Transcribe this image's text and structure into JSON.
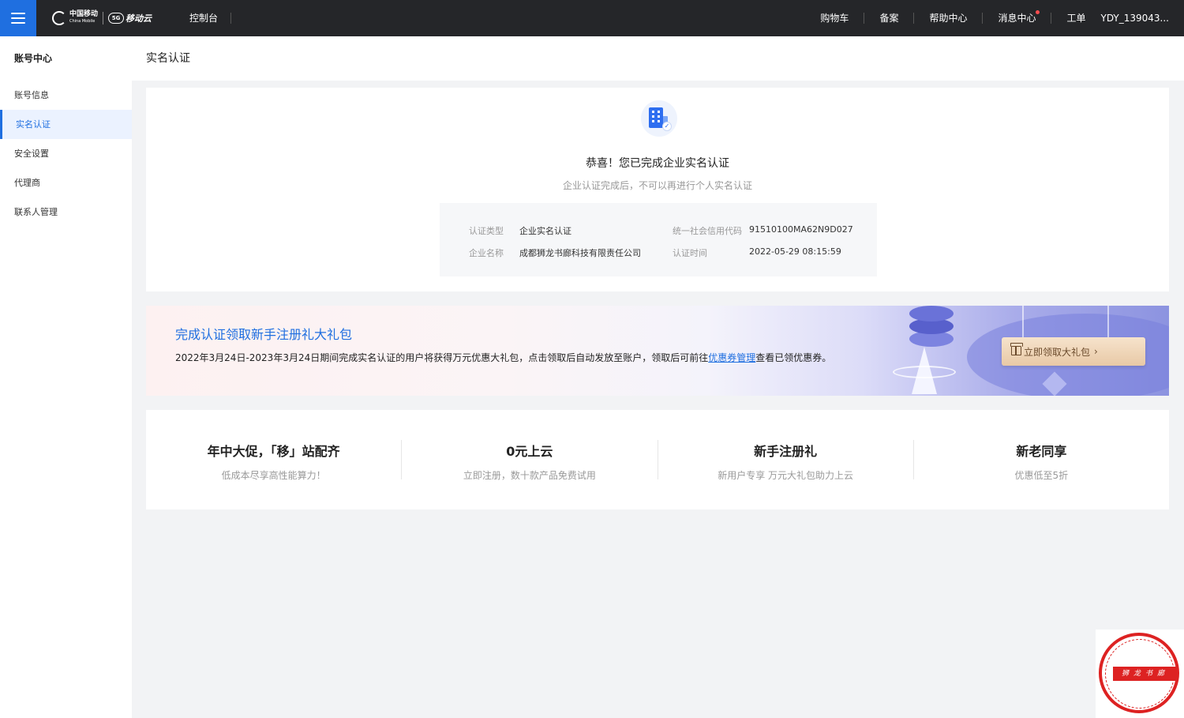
{
  "topbar": {
    "logo_zh": "中国移动",
    "logo_en": "China Mobile",
    "logo_5g": "5G",
    "logo_cloud": "移动云",
    "console": "控制台",
    "links": [
      "购物车",
      "备案",
      "帮助中心",
      "消息中心",
      "工单"
    ],
    "user": "YDY_139043..."
  },
  "sidebar": {
    "title": "账号中心",
    "items": [
      {
        "label": "账号信息"
      },
      {
        "label": "实名认证"
      },
      {
        "label": "安全设置"
      },
      {
        "label": "代理商"
      },
      {
        "label": "联系人管理"
      }
    ],
    "active_index": 1
  },
  "page": {
    "title": "实名认证"
  },
  "verification": {
    "congrats": "恭喜！您已完成企业实名认证",
    "note": "企业认证完成后，不可以再进行个人实名认证",
    "fields": {
      "type_label": "认证类型",
      "type_value": "企业实名认证",
      "code_label": "统一社会信用代码",
      "code_value": "91510100MA62N9D027",
      "name_label": "企业名称",
      "name_value": "成都狮龙书廊科技有限责任公司",
      "time_label": "认证时间",
      "time_value": "2022-05-29 08:15:59"
    }
  },
  "banner": {
    "title": "完成认证领取新手注册礼大礼包",
    "desc_before": "2022年3月24日-2023年3月24日期间完成实名认证的用户将获得万元优惠大礼包，点击领取后自动发放至账户，领取后可前往",
    "desc_link": "优惠券管理",
    "desc_after": "查看已领优惠券。",
    "button": "立即领取大礼包",
    "button_arrow": "›"
  },
  "promos": [
    {
      "title": "年中大促，「移」站配齐",
      "sub": "低成本尽享高性能算力！"
    },
    {
      "title": "0元上云",
      "sub": "立即注册，数十款产品免费试用"
    },
    {
      "title": "新手注册礼",
      "sub": "新用户专享 万元大礼包助力上云"
    },
    {
      "title": "新老同享",
      "sub": "优惠低至5折"
    }
  ],
  "seal": {
    "text": "狮龙书廊"
  },
  "colors": {
    "topbar": "#252629",
    "accent": "#1f6fe0",
    "background": "#f2f3f5",
    "gift_button": "#e8c9a6"
  }
}
